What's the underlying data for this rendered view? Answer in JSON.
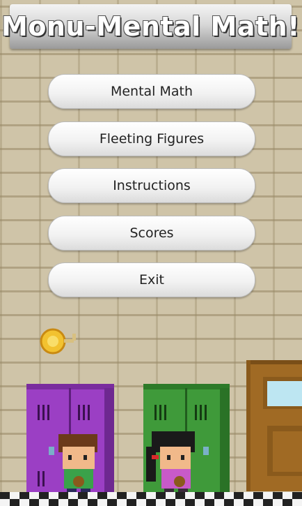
{
  "title": "Monu-Mental Math!",
  "menu": [
    {
      "label": "Mental Math",
      "name": "mental-math-button"
    },
    {
      "label": "Fleeting Figures",
      "name": "fleeting-figures-button"
    },
    {
      "label": "Instructions",
      "name": "instructions-button"
    },
    {
      "label": "Scores",
      "name": "scores-button"
    },
    {
      "label": "Exit",
      "name": "exit-button"
    }
  ],
  "colors": {
    "purple_locker": "#9b3fc4",
    "green_locker": "#3f9a3a",
    "door": "#a06a24",
    "coin": "#f2c230"
  },
  "icons": [
    "gold-coin-icon",
    "purple-locker",
    "green-locker",
    "wooden-door",
    "boy-character",
    "girl-character"
  ]
}
